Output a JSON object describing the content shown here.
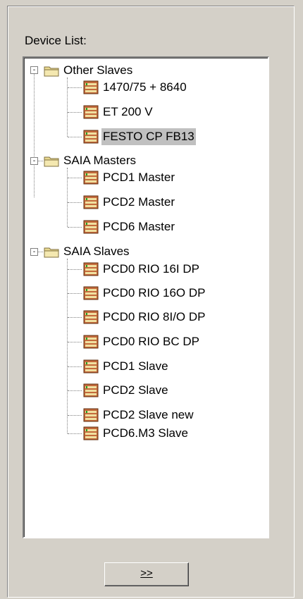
{
  "device_list": {
    "label": "Device List:",
    "groups": [
      {
        "name": "Other Slaves",
        "expanded": true,
        "toggle": "-",
        "items": [
          "1470/75 + 8640",
          "ET 200 V",
          "FESTO CP FB13"
        ]
      },
      {
        "name": "SAIA Masters",
        "expanded": true,
        "toggle": "-",
        "items": [
          "PCD1 Master",
          "PCD2 Master",
          "PCD6 Master"
        ]
      },
      {
        "name": "SAIA Slaves",
        "expanded": true,
        "toggle": "-",
        "items": [
          "PCD0 RIO 16I DP",
          "PCD0 RIO 16O DP",
          "PCD0 RIO 8I/O DP",
          "PCD0 RIO BC DP",
          "PCD1 Slave",
          "PCD2 Slave",
          "PCD2 Slave new",
          "PCD6.M3 Slave"
        ]
      }
    ],
    "selected_item": "FESTO CP FB13"
  },
  "add_button": {
    "label": ">>"
  },
  "colors": {
    "window_bg": "#d4d0c8",
    "selection": "#c0c0c0",
    "folder": "#e8d890",
    "device": "#c46a3c"
  },
  "icons": {
    "folder": "folder-icon",
    "device": "device-icon",
    "expander": "collapse-icon"
  }
}
